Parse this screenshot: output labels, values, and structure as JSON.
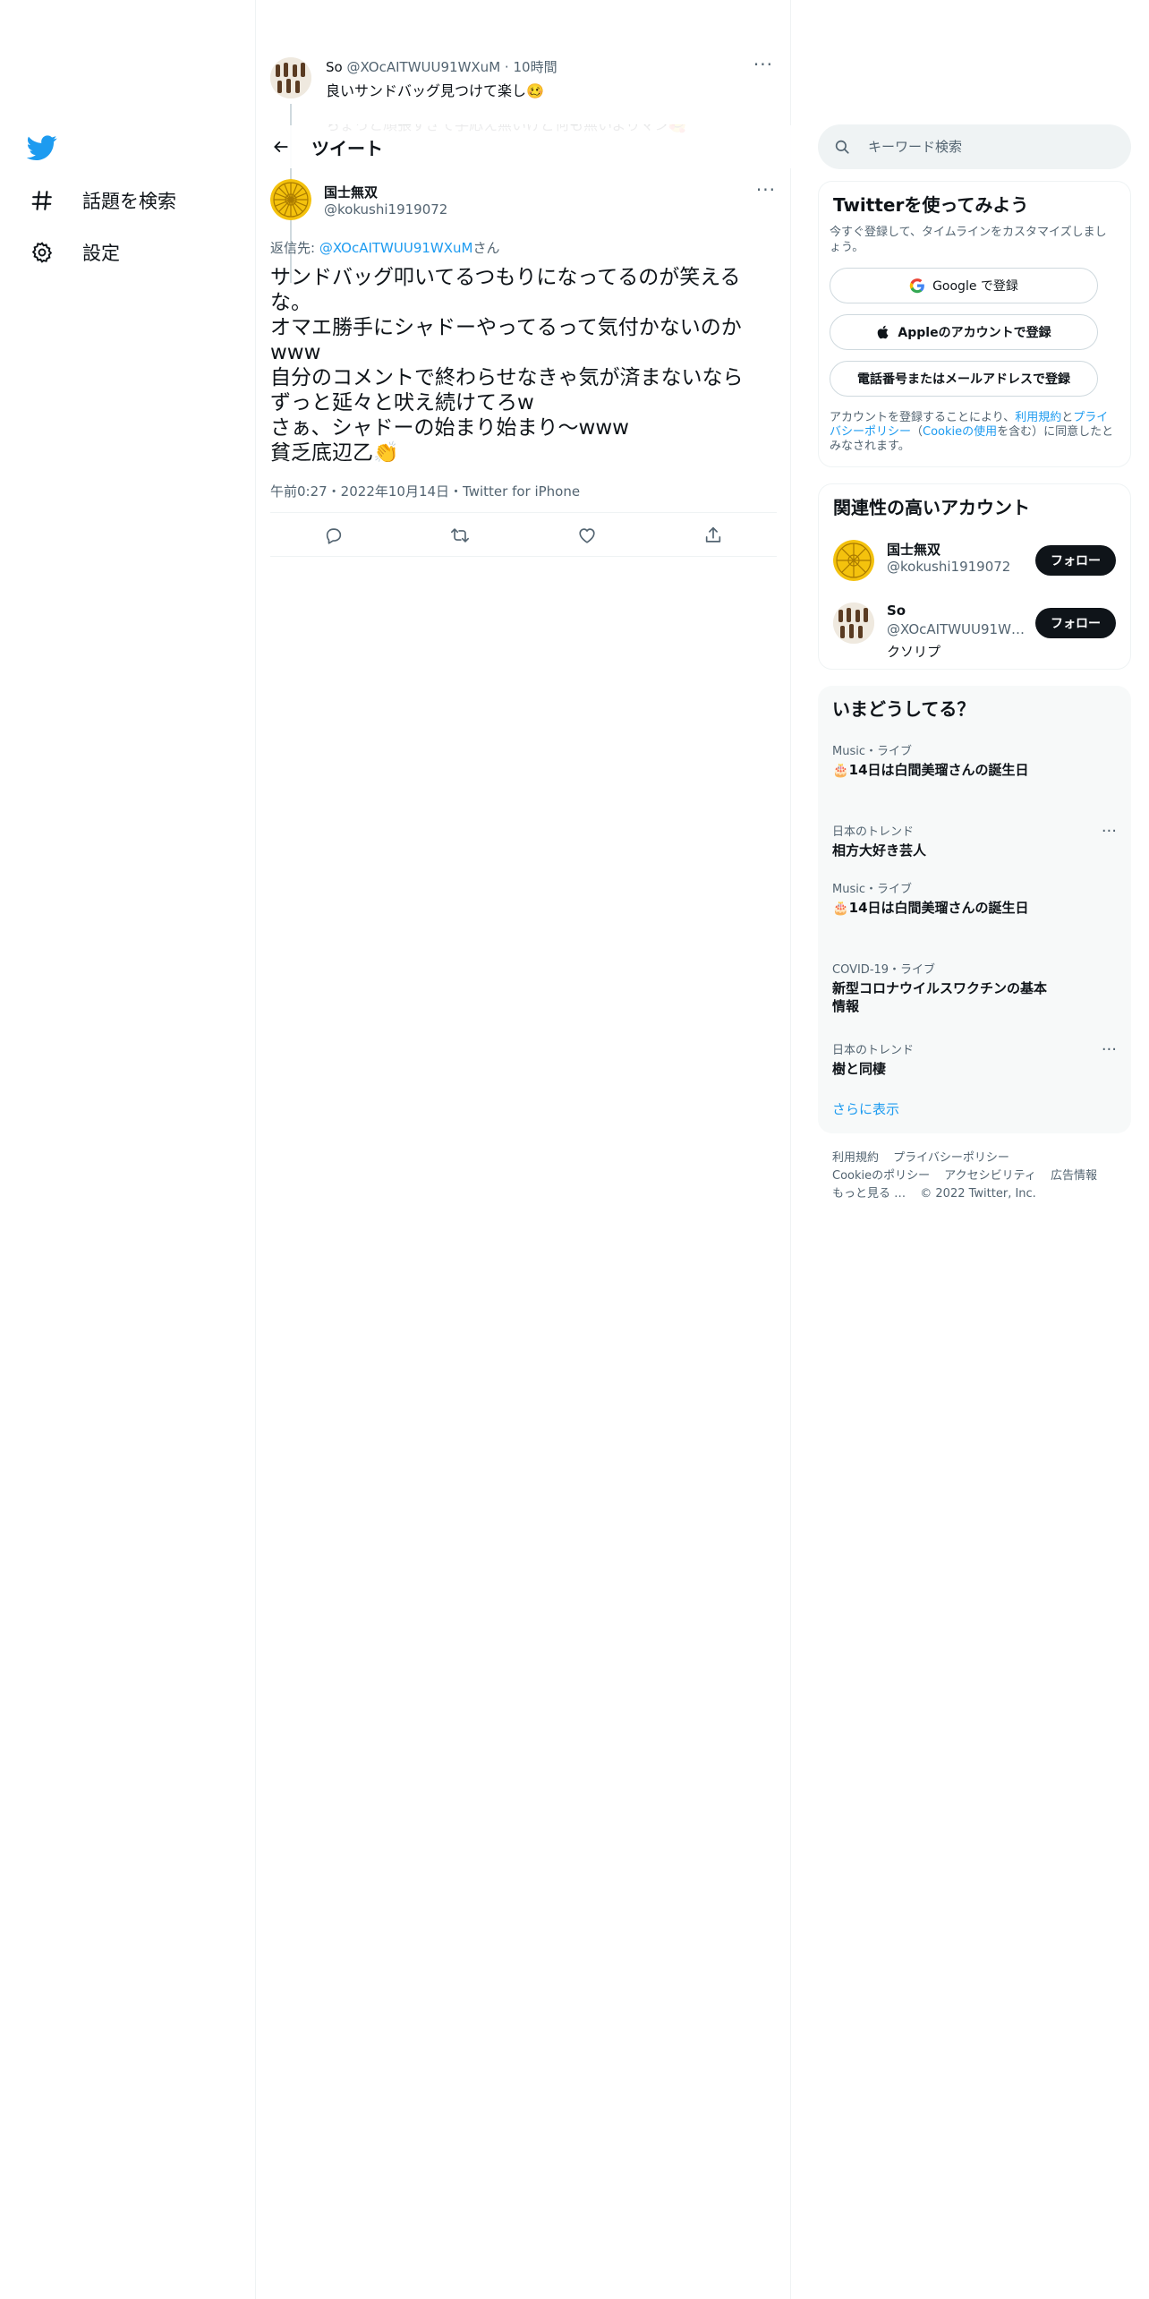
{
  "nav": {
    "explore_label": "話題を検索",
    "settings_label": "設定"
  },
  "prev_tweet": {
    "name": "So",
    "handle": "@XOcAITWUU91WXuM",
    "time": "10時間",
    "text": "良いサンドバッグ見つけて楽し🥴",
    "text2": "ちょっと頑張すぎて手応え無いけど何も無いよりマシ🥰"
  },
  "header": {
    "title": "ツイート"
  },
  "tweet": {
    "name": "国士無双",
    "handle": "@kokushi1919072",
    "reply_prefix": "返信先: ",
    "reply_handle": "@XOcAITWUU91WXuM",
    "reply_suffix": "さん",
    "lines": [
      "サンドバッグ叩いてるつもりになってるのが笑える",
      "な。",
      "オマエ勝手にシャドーやってるって気付かないのか",
      "www",
      "自分のコメントで終わらせなきゃ気が済まないなら",
      "ずっと延々と吠え続けてろw",
      "さぁ、シャドーの始まり始まり〜www",
      "貧乏底辺乙👏"
    ],
    "meta": "午前0:27・2022年10月14日・Twitter for iPhone"
  },
  "search": {
    "placeholder": "キーワード検索"
  },
  "signup": {
    "title": "Twitterを使ってみよう",
    "desc": "今すぐ登録して、タイムラインをカスタマイズしましょう。",
    "google_label": "Google で登録",
    "apple_label": "Appleのアカウントで登録",
    "phone_label": "電話番号またはメールアドレスで登録",
    "terms_1": "アカウントを登録することにより、",
    "terms_tos": "利用規約",
    "terms_2": "と",
    "terms_pp": "プライバシーポリシー",
    "terms_3": "（",
    "terms_cookie": "Cookieの使用",
    "terms_4": "を含む）に同意したとみなされます。"
  },
  "accounts": {
    "title": "関連性の高いアカウント",
    "items": [
      {
        "name": "国士無双",
        "handle": "@kokushi1919072",
        "bio": "",
        "follow_label": "フォロー"
      },
      {
        "name": "So",
        "handle": "@XOcAITWUU91WXuM",
        "bio": "クソリプ",
        "follow_label": "フォロー"
      }
    ]
  },
  "trends": {
    "title": "いまどうしてる？",
    "items": [
      {
        "category": "Music・ライブ",
        "title": "🎂14日は白間美瑠さんの誕生日"
      },
      {
        "category": "日本のトレンド",
        "title": "相方大好き芸人"
      },
      {
        "category": "Music・ライブ",
        "title": "🎂14日は白間美瑠さんの誕生日"
      },
      {
        "category": "COVID-19・ライブ",
        "title": "新型コロナウイルスワクチンの基本情報"
      },
      {
        "category": "日本のトレンド",
        "title": "樹と同棲"
      }
    ],
    "show_more": "さらに表示"
  },
  "footer": {
    "tos": "利用規約",
    "privacy": "プライバシーポリシー",
    "cookie": "Cookieのポリシー",
    "accessibility": "アクセシビリティ",
    "ads": "広告情報",
    "more": "もっと見る …",
    "copyright": "© 2022 Twitter, Inc."
  },
  "colors": {
    "accent": "#1d9bf0",
    "text": "#0f1419",
    "muted": "#536471",
    "border": "#eff3f4",
    "card_bg": "#f7f9f9"
  },
  "icons": [
    "twitter-logo-icon",
    "hashtag-icon",
    "gear-icon",
    "back-arrow-icon",
    "more-dots-icon",
    "reply-icon",
    "retweet-icon",
    "like-icon",
    "share-icon",
    "search-icon",
    "google-icon",
    "apple-icon"
  ]
}
